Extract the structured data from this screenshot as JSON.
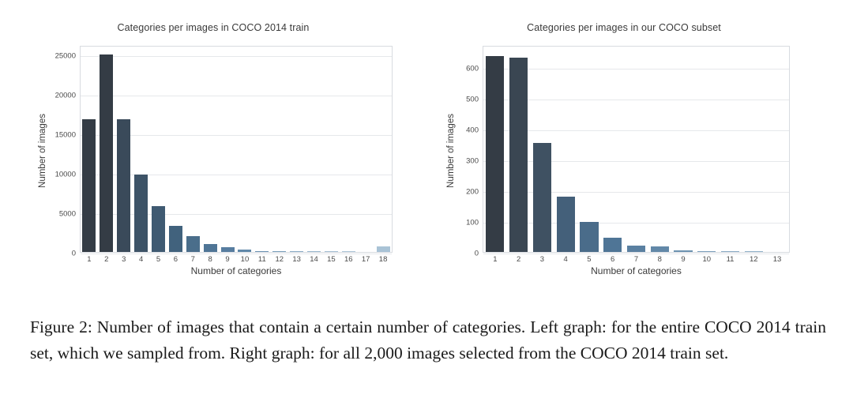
{
  "figure": {
    "caption": "Figure 2: Number of images that contain a certain number of categories. Left graph: for the entire COCO 2014 train set, which we sampled from. Right graph: for all 2,000 images selected from the COCO 2014 train set."
  },
  "chart_data": [
    {
      "type": "bar",
      "id": "coco-2014-train",
      "title": "Categories per images in COCO 2014 train",
      "xlabel": "Number of categories",
      "ylabel": "Number of images",
      "categories": [
        "1",
        "2",
        "3",
        "4",
        "5",
        "6",
        "7",
        "8",
        "9",
        "10",
        "11",
        "12",
        "13",
        "14",
        "15",
        "16",
        "17",
        "18"
      ],
      "values": [
        16800,
        25000,
        16850,
        9850,
        5850,
        3350,
        2000,
        1020,
        570,
        310,
        140,
        55,
        15,
        5,
        2,
        1,
        0,
        700
      ],
      "ylim": [
        0,
        26200
      ],
      "yticks": [
        0,
        5000,
        10000,
        15000,
        20000,
        25000
      ],
      "ytick_labels": [
        "0",
        "5000",
        "10000",
        "15000",
        "20000",
        "25000"
      ],
      "grid": true,
      "legend": "none",
      "bar_colors": [
        "#343c45",
        "#343c45",
        "#3a4a5a",
        "#3d5367",
        "#3f5a72",
        "#41627d",
        "#4a6e8b",
        "#4f7596",
        "#577da0",
        "#6088a9",
        "#6b92b2",
        "#7ba0bd",
        "#8cadc6",
        "#9ab8ce",
        "#a5c0d4",
        "#adc6d8",
        "#b3cadb",
        "#a9c3d6"
      ]
    },
    {
      "type": "bar",
      "id": "our-coco-subset",
      "title": "Categories per images in our COCO subset",
      "xlabel": "Number of categories",
      "ylabel": "Number of images",
      "categories": [
        "1",
        "2",
        "3",
        "4",
        "5",
        "6",
        "7",
        "8",
        "9",
        "10",
        "11",
        "12",
        "13"
      ],
      "values": [
        637,
        632,
        355,
        180,
        97,
        47,
        21,
        18,
        5,
        3,
        1,
        3,
        0
      ],
      "ylim": [
        0,
        672
      ],
      "yticks": [
        0,
        100,
        200,
        300,
        400,
        500,
        600
      ],
      "ytick_labels": [
        "0",
        "100",
        "200",
        "300",
        "400",
        "500",
        "600"
      ],
      "grid": true,
      "legend": "none",
      "bar_colors": [
        "#343c45",
        "#3a4652",
        "#3f5162",
        "#44607a",
        "#4a6c8a",
        "#4f7596",
        "#5a80a1",
        "#6288a8",
        "#6e93b1",
        "#7da0bc",
        "#8bacc5",
        "#93b3ca",
        "#9fbcd0"
      ]
    }
  ]
}
